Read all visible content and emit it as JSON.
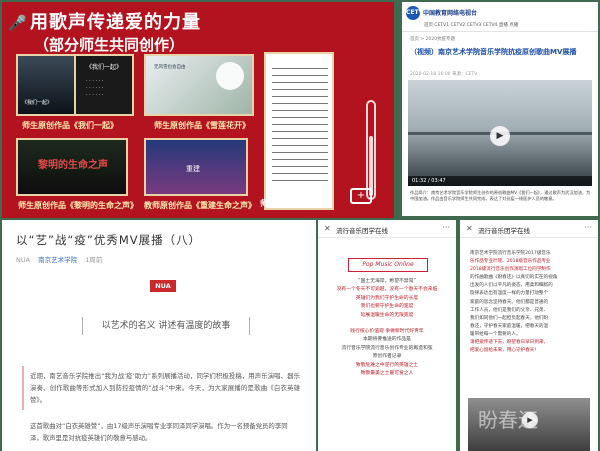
{
  "collage": {
    "title": "用歌声传递爱的力量",
    "subtitle": "（部分师生共同创作）",
    "cards": [
      {
        "caption": "师生原创作品《我们一起》",
        "poster": "《我们一起》"
      },
      {
        "caption": "师生原创作品《雪莲花开》",
        "poster": "无风雪也会自由"
      },
      {
        "caption": "师生原创作品《黎明的生命之声》",
        "poster": "黎明的生命之声"
      },
      {
        "caption": "教师原创作品《重建生命之声》",
        "poster": "重建"
      },
      {
        "caption": "师生《重逢日》",
        "poster": ""
      }
    ]
  },
  "news": {
    "site_name": "中国教育网络电视台",
    "logo": "CETV",
    "nav": "首页  CETV1  CETV2  CETV3  CETV4  直播  点播",
    "breadcrumb": "首页 > 2020抗疫专题",
    "title": "（视频）南京艺术学院音乐学院抗疫原创歌曲MV展播",
    "meta": "2020-02-18 16:00  来源：CETV",
    "video_caption": "01:32 / 03:47",
    "body": "作品简介：南京艺术学院音乐学院师生创作的原创歌曲MV《我们一起》，通过歌声为武汉加油，为中国加油。作品由音乐学院师生共同完成，表达了对抗疫一线医护人员的敬意。"
  },
  "article": {
    "title": "以“艺”战“疫”优秀MV展播（八）",
    "source": "NUA",
    "account": "南京艺术学院",
    "date": "1周前",
    "badge": "NUA",
    "slogan": "以艺术的名义 讲述有温度的故事",
    "para1": "近期，南艺音乐学院推出“我为战‘疫’助力”系列展播活动，同学们积极投稿，用声乐演唱、器乐演奏、创作歌曲等形式加入到防控疫情的“战斗”中来。今天，为大家展播的是歌曲《白衣英雄赞》。",
    "para2": "这首歌曲对“白衣英雄赞”，由17级声乐演唱专业李同泽同学演唱。作为一名预备党员的李同泽，歌声里是对抗疫英雄们的敬意与感动。"
  },
  "phoneA": {
    "close": "✕",
    "name": "流行音乐团学在线",
    "more": "···",
    "mark": "Pop Music Online",
    "lyrics": [
      {
        "text": "“国土无海岸，希望不禁渴”",
        "dark": true
      },
      {
        "text": "没有一个冬天不可逾越，没有一个春天不会来临",
        "dark": false
      },
      {
        "text": "英雄们为我们守护生命的长度",
        "dark": false
      },
      {
        "text": "我们也要守护生命的宽度",
        "dark": false
      },
      {
        "text": "延展温暖生命的无限宽度",
        "dark": false
      },
      {
        "text": "",
        "gap": true
      },
      {
        "text": "践行核心价值观 争做新时代好青年",
        "dark": false
      },
      {
        "text": "本期将要推送的作品是",
        "dark": true
      },
      {
        "text": "流行音乐学院流行音乐创作专业的再造和弦",
        "dark": true
      },
      {
        "text": "原创作者记录",
        "dark": true
      },
      {
        "text": "致敬危难之中逆行的英雄之士",
        "dark": false
      },
      {
        "text": "致敬最美之士最可爱之人",
        "dark": false
      }
    ]
  },
  "phoneB": {
    "close": "✕",
    "name": "流行音乐团学在线",
    "more": "···",
    "para": [
      {
        "text": "南京艺术学院流行音乐学院2017级音乐",
        "red": false
      },
      {
        "text": "乐作品专业叶瑶、2018级音乐作品专业",
        "red": true
      },
      {
        "text": "2018级流行音乐创作演唱工位同学制作",
        "red": true
      },
      {
        "text": "的作曲歌曲《盼春还》以真切的实在的视角",
        "red": false
      },
      {
        "text": "出发的人们以平凡的姿态，用柔和细腻的",
        "red": false
      },
      {
        "text": "旋律表达出有温度一样的力量打动整个",
        "red": false
      },
      {
        "text": "家庭的思念坚持春天。他们都是普通的",
        "red": false
      },
      {
        "text": "工作人员，他们是我们的父亲、兄弟、",
        "red": false
      },
      {
        "text": "我们如同他们一起担负起春天，他们盼",
        "red": false
      },
      {
        "text": "春还，守护春天家庭温暖，把春天的温",
        "red": false
      },
      {
        "text": "暖带给每一个需要的人。",
        "red": false
      },
      {
        "text": "请把爱传递下去，盼望春日早日到来，",
        "red": true
      },
      {
        "text": "把爱心留给未来，用心守护春天！",
        "red": true
      }
    ],
    "video_text": "盼春还"
  }
}
